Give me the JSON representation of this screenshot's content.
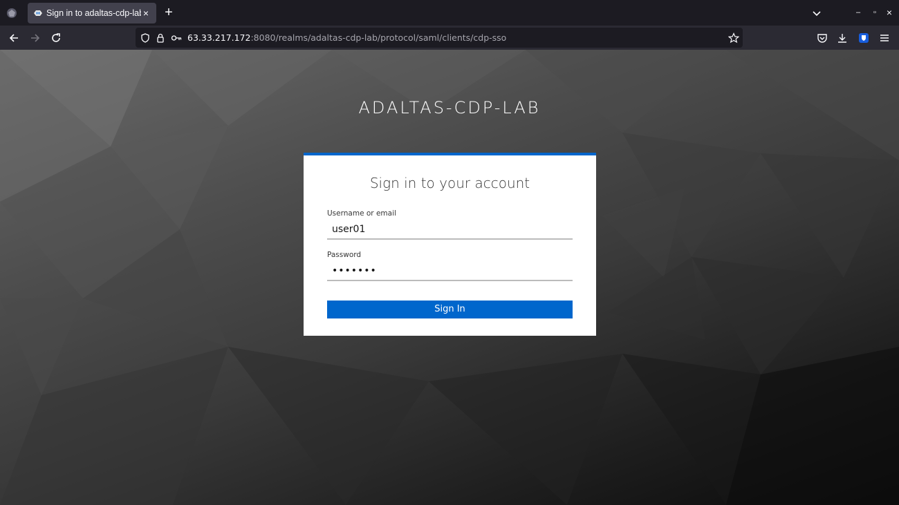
{
  "browser": {
    "tab_title": "Sign in to adaltas-cdp-lab",
    "tab_close": "×",
    "new_tab": "+",
    "url_host": "63.33.217.172",
    "url_rest": ":8080/realms/adaltas-cdp-lab/protocol/saml/clients/cdp-sso",
    "window_controls": {
      "minimize": "–",
      "restore": "▫",
      "close": "×"
    },
    "icons": {
      "app": "firefox-icon",
      "back": "back-arrow-icon",
      "forward": "forward-arrow-icon",
      "reload": "reload-icon",
      "tracking": "shield-icon",
      "lock": "lock-icon",
      "permissions": "key-icon",
      "bookmark": "star-icon",
      "pocket": "pocket-icon",
      "downloads": "download-icon",
      "extension": "bitwarden-shield-icon",
      "menu": "hamburger-menu-icon"
    }
  },
  "page": {
    "realm_title": "ADALTAS-CDP-LAB",
    "card_title": "Sign in to your account",
    "username_label": "Username or email",
    "username_value": "user01",
    "password_label": "Password",
    "password_value": "•••••••",
    "signin_label": "Sign In"
  },
  "colors": {
    "accent": "#0066cc",
    "tab_bg": "#42414d",
    "toolbar_bg": "#2b2a33",
    "chrome_bg": "#1c1b22"
  }
}
